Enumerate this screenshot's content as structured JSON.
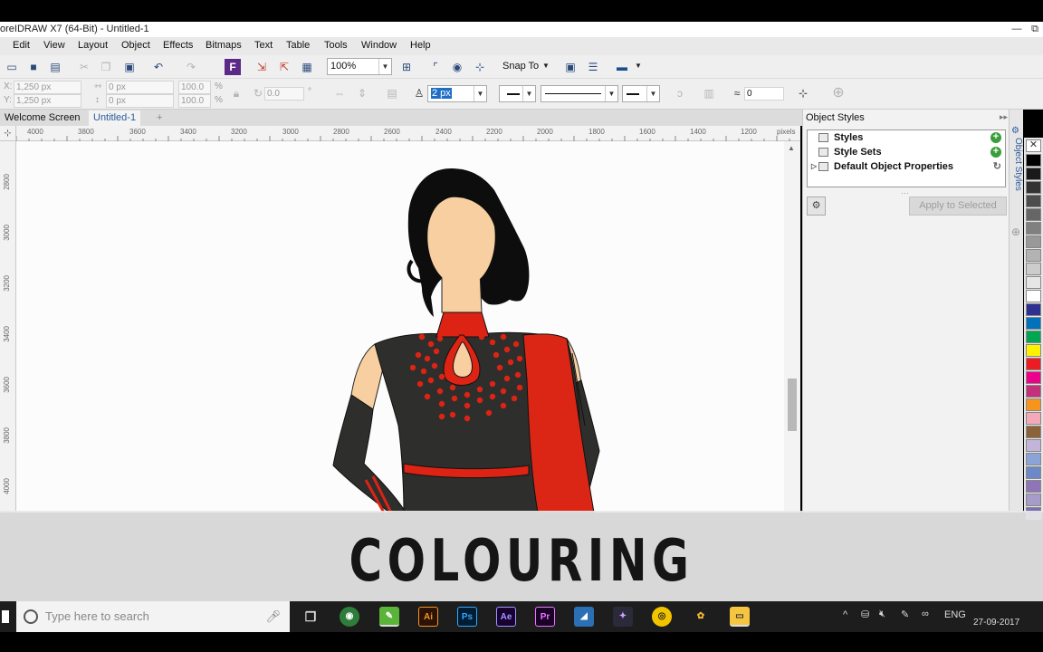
{
  "window": {
    "title": "oreIDRAW X7 (64-Bit) - Untitled-1",
    "minimize": "—",
    "restore": "⧉"
  },
  "menu": [
    "Edit",
    "View",
    "Layout",
    "Object",
    "Effects",
    "Bitmaps",
    "Text",
    "Table",
    "Tools",
    "Window",
    "Help"
  ],
  "toolbar": {
    "zoom_value": "100%",
    "snap_label": "Snap To"
  },
  "property_bar": {
    "x_value": "1,250 px",
    "y_value": "1,250 px",
    "width_value": "0 px",
    "height_value": "0 px",
    "scale_x": "100.0",
    "scale_y": "100.0",
    "percent": "%",
    "angle_value": "0.0",
    "degree": "°",
    "outline_width": "2 px",
    "corner_value": "0"
  },
  "tabs": [
    "Welcome Screen",
    "Untitled-1"
  ],
  "ruler": {
    "h_ticks": [
      "4000",
      "3800",
      "3600",
      "3400",
      "3200",
      "3000",
      "2800",
      "2600",
      "2400",
      "2200",
      "2000",
      "1800",
      "1600",
      "1400",
      "1200"
    ],
    "h_unit": "pixels",
    "v_ticks": [
      "2800",
      "3000",
      "3200",
      "3400",
      "3600",
      "3800",
      "4000"
    ]
  },
  "docker": {
    "title": "Object Styles",
    "items": [
      "Styles",
      "Style Sets",
      "Default Object Properties"
    ],
    "apply_button": "Apply to Selected",
    "vertical_tab": "Object Styles"
  },
  "palette_colors": [
    "#000000",
    "#1a1a1a",
    "#333333",
    "#4d4d4d",
    "#666666",
    "#808080",
    "#999999",
    "#b3b3b3",
    "#cccccc",
    "#e6e6e6",
    "#ffffff",
    "#2e3192",
    "#0072bc",
    "#00a651",
    "#fff200",
    "#ed1c24",
    "#ec008c",
    "#c4307a",
    "#f7941d",
    "#f5a9b8",
    "#8c6239",
    "#c2b5d9",
    "#8ba3d6",
    "#6d88c7",
    "#8f75b8",
    "#a69bc9",
    "#7b6fb0"
  ],
  "overlay": {
    "caption": "COLOURING"
  },
  "taskbar": {
    "search_placeholder": "Type here to search",
    "apps": [
      "Ai",
      "Ps",
      "Ae",
      "Pr"
    ],
    "language": "ENG",
    "date": "27-09-2017"
  },
  "illustration": {
    "colors": {
      "hair": "#0d0d0d",
      "skin": "#f7cfa0",
      "dress": "#2e2e2c",
      "accent_red": "#dd2314",
      "dupatta": "#db2616"
    }
  }
}
